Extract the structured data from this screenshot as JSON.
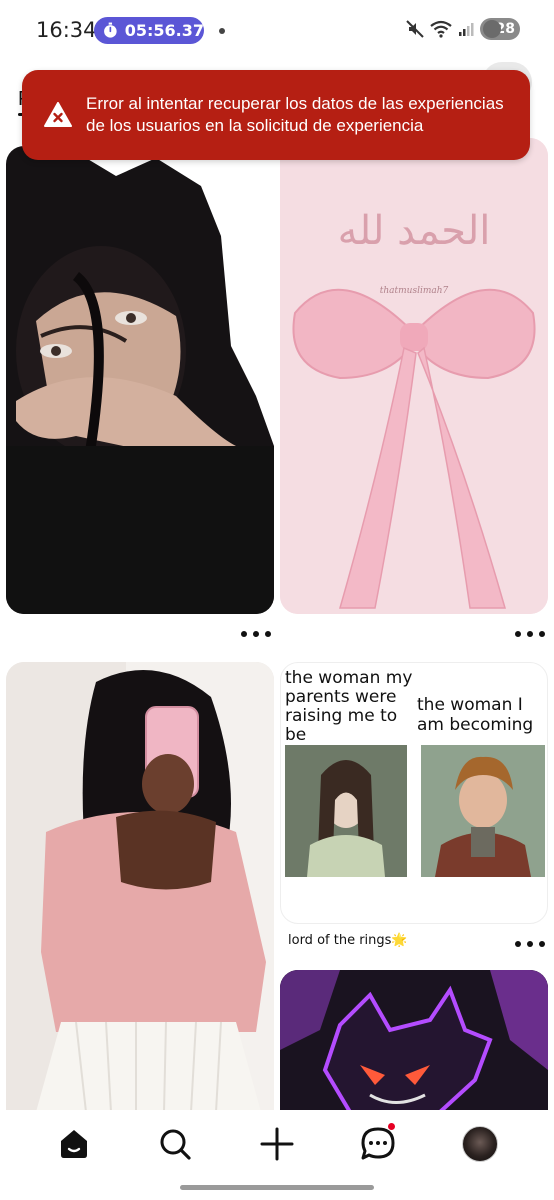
{
  "status_bar": {
    "time": "16:34",
    "timer": "05:56.37",
    "battery": "28",
    "icons": [
      "mute-icon",
      "wifi-icon",
      "signal-icon",
      "battery-icon"
    ]
  },
  "header": {
    "partial_letter": "P"
  },
  "toast": {
    "message": "Error al intentar recuperar los datos de las experiencias de los usuarios en la solicitud de experiencia",
    "color": "#b51f13",
    "icon": "warning-icon"
  },
  "pins": [
    {
      "title": "",
      "image": "dark-haired-woman-portrait"
    },
    {
      "title": "",
      "image": "pink-bow-calligraphy",
      "calligraphy": "الحمد لله",
      "signature": "thatmuslimah7"
    },
    {
      "title": "",
      "image": "mirror-selfie-pink-cardigan"
    },
    {
      "title": "lord of the rings🌟",
      "image": "meme-lord-of-the-rings",
      "caption_left": "the woman my parents were raising me to be",
      "caption_right": "the woman I am becoming"
    },
    {
      "title": "",
      "image": "purple-gengar-art"
    }
  ],
  "bottom_nav": {
    "items": [
      "home-icon",
      "search-icon",
      "create-icon",
      "messages-icon",
      "profile-avatar"
    ],
    "badge_color": "#e60023"
  }
}
